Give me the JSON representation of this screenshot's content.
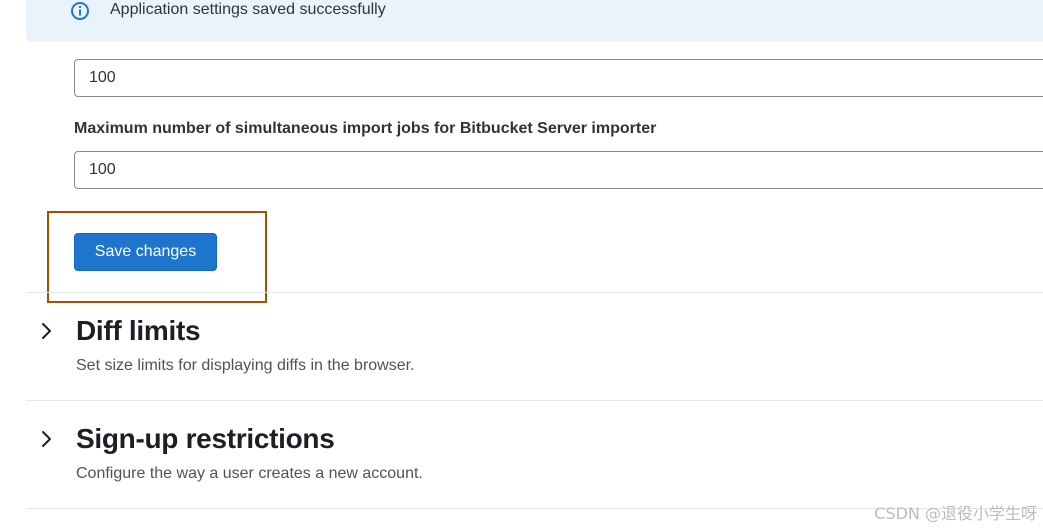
{
  "alert": {
    "message": "Application settings saved successfully",
    "icon": "info-icon",
    "color": "#1f75cb"
  },
  "fields": [
    {
      "value": "100"
    },
    {
      "label": "Maximum number of simultaneous import jobs for Bitbucket Server importer",
      "value": "100"
    }
  ],
  "form": {
    "save_label": "Save changes"
  },
  "sections": [
    {
      "title": "Diff limits",
      "description": "Set size limits for displaying diffs in the browser."
    },
    {
      "title": "Sign-up restrictions",
      "description": "Configure the way a user creates a new account."
    }
  ],
  "watermark": "CSDN @退役小学生呀",
  "colors": {
    "primary_button": "#1f75cb",
    "alert_background": "#e9f3fc",
    "highlight_border": "#a35200"
  }
}
